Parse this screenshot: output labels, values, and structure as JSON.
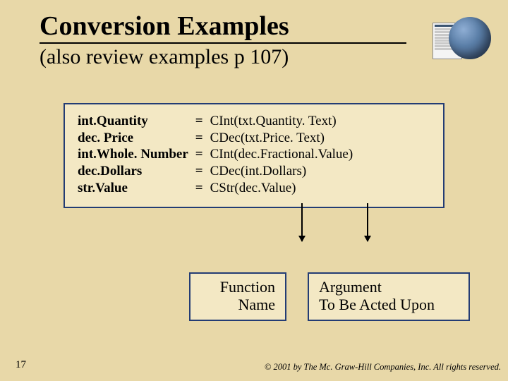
{
  "title": "Conversion Examples",
  "subtitle": "(also review examples p 107)",
  "code": {
    "rows": [
      {
        "lhs": "int.Quantity",
        "eq": "=",
        "rhs": "CInt(txt.Quantity. Text)"
      },
      {
        "lhs": "dec. Price",
        "eq": "=",
        "rhs": "CDec(txt.Price. Text)"
      },
      {
        "lhs": "int.Whole. Number",
        "eq": "=",
        "rhs": "CInt(dec.Fractional.Value)"
      },
      {
        "lhs": "dec.Dollars",
        "eq": "=",
        "rhs": "CDec(int.Dollars)"
      },
      {
        "lhs": "str.Value",
        "eq": "=",
        "rhs": "CStr(dec.Value)"
      }
    ]
  },
  "labels": {
    "function_l1": "Function",
    "function_l2": "Name",
    "argument_l1": "Argument",
    "argument_l2": "To Be Acted Upon"
  },
  "page_number": "17",
  "copyright": "© 2001 by The Mc. Graw-Hill Companies, Inc. All rights reserved."
}
